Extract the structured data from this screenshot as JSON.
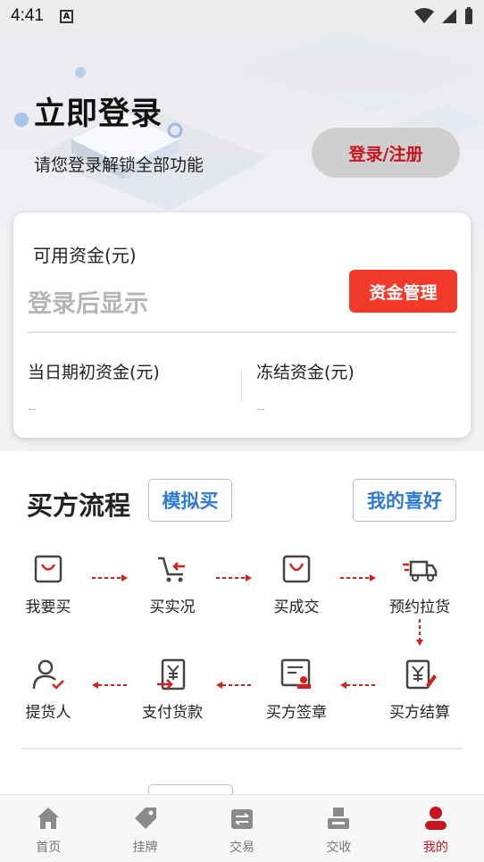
{
  "status_bar": {
    "time": "4:41",
    "indicator": "A"
  },
  "hero": {
    "title": "立即登录",
    "subtitle": "请您登录解锁全部功能",
    "login_button": "登录/注册"
  },
  "fund_card": {
    "available_label": "可用资金(元)",
    "placeholder": "登录后显示",
    "manage_button": "资金管理",
    "opening_label": "当日期初资金(元)",
    "opening_value": "--",
    "frozen_label": "冻结资金(元)",
    "frozen_value": "--"
  },
  "buyer_flow": {
    "title": "买方流程",
    "simulate_button": "模拟买",
    "favorites_button": "我的喜好",
    "steps": [
      {
        "label": "我要买",
        "icon": "shopping-bag-icon"
      },
      {
        "label": "买实况",
        "icon": "cart-arrow-icon"
      },
      {
        "label": "买成交",
        "icon": "shopping-bag-icon"
      },
      {
        "label": "预约拉货",
        "icon": "truck-icon"
      },
      {
        "label": "买方结算",
        "icon": "settlement-icon"
      },
      {
        "label": "买方签章",
        "icon": "seal-document-icon"
      },
      {
        "label": "支付货款",
        "icon": "payment-icon"
      },
      {
        "label": "提货人",
        "icon": "person-check-icon"
      }
    ]
  },
  "tabbar": {
    "items": [
      {
        "label": "首页",
        "icon": "home-icon"
      },
      {
        "label": "挂牌",
        "icon": "tag-icon"
      },
      {
        "label": "交易",
        "icon": "exchange-icon"
      },
      {
        "label": "交收",
        "icon": "delivery-icon"
      },
      {
        "label": "我的",
        "icon": "user-icon"
      }
    ],
    "active_color": "#c8141c",
    "inactive_color": "#777777"
  }
}
